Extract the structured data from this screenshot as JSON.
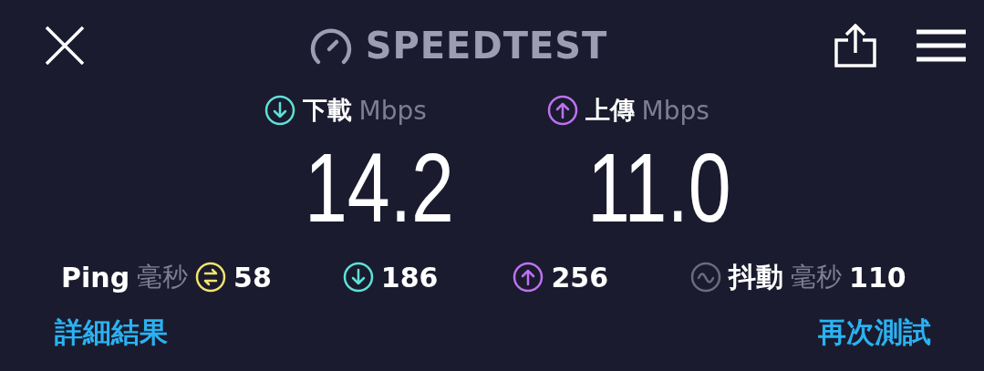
{
  "header": {
    "title": "SPEEDTEST"
  },
  "results": [
    {
      "kind": "download",
      "label": "下載",
      "unit": "Mbps",
      "value": "14.2",
      "color": "#5fe0d8"
    },
    {
      "kind": "upload",
      "label": "上傳",
      "unit": "Mbps",
      "value": "11.0",
      "color": "#bd72f0"
    }
  ],
  "stats": [
    {
      "kind": "ping",
      "label": "Ping",
      "unit": "毫秒",
      "value": "58",
      "color": "#f2e36e"
    },
    {
      "kind": "download",
      "value": "186",
      "color": "#5fe0d8"
    },
    {
      "kind": "upload",
      "value": "256",
      "color": "#bd72f0"
    },
    {
      "kind": "jitter",
      "label": "抖動",
      "unit": "毫秒",
      "value": "110",
      "color": "#6a6b7c"
    }
  ],
  "links": [
    "詳細結果",
    "再次測試"
  ]
}
